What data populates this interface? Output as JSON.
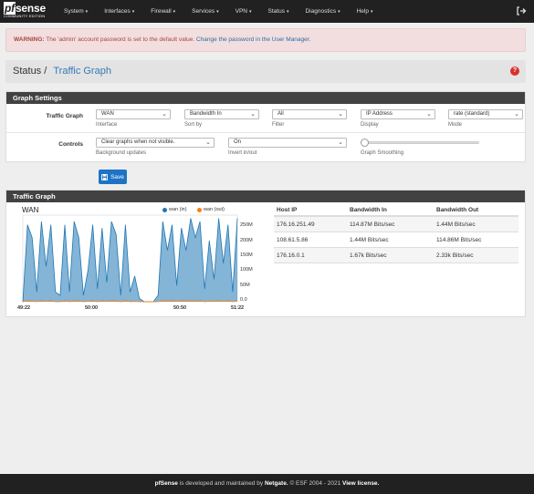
{
  "nav": {
    "logo_main": "sense",
    "logo_pf": "pf",
    "logo_sub": "COMMUNITY EDITION",
    "menu": [
      "System",
      "Interfaces",
      "Firewall",
      "Services",
      "VPN",
      "Status",
      "Diagnostics",
      "Help"
    ]
  },
  "alert": {
    "prefix": "WARNING:",
    "text": " The 'admin' account password is set to the default value. ",
    "link": "Change the password in the User Manager."
  },
  "breadcrumb": {
    "parent": "Status",
    "sep": "/",
    "current": "Traffic Graph"
  },
  "settings": {
    "title": "Graph Settings",
    "traffic_graph_label": "Traffic Graph",
    "interface": {
      "value": "WAN",
      "hint": "Interface"
    },
    "sortby": {
      "value": "Bandwidth In",
      "hint": "Sort by"
    },
    "filter": {
      "value": "All",
      "hint": "Filter"
    },
    "display": {
      "value": "IP Address",
      "hint": "Display"
    },
    "mode": {
      "value": "rate (standard)",
      "hint": "Mode"
    },
    "controls_label": "Controls",
    "background": {
      "value": "Clear graphs when not visible.",
      "hint": "Background updates"
    },
    "invert": {
      "value": "On",
      "hint": "Invert in/out"
    },
    "smoothing": {
      "hint": "Graph Smoothing",
      "level": 0
    },
    "save_label": "Save"
  },
  "graph_panel": {
    "title": "Traffic Graph",
    "chart_title": "WAN",
    "legend_in": "wan (in)",
    "legend_out": "wan (out)",
    "colors": {
      "in": "#1f77b4",
      "out": "#ff7f0e"
    },
    "y_ticks": [
      "250M",
      "200M",
      "150M",
      "100M",
      "50M",
      "0.0"
    ],
    "x_ticks": [
      "49:22",
      "50:00",
      "50:50",
      "51:22"
    ]
  },
  "chart_data": {
    "type": "area",
    "title": "WAN",
    "xlabel": "",
    "ylabel": "",
    "ylim": [
      0,
      270
    ],
    "x_tick_labels": [
      "49:22",
      "50:00",
      "50:50",
      "51:22"
    ],
    "series": [
      {
        "name": "wan (in)",
        "values": [
          0,
          240,
          200,
          30,
          250,
          110,
          240,
          30,
          20,
          240,
          30,
          250,
          200,
          20,
          100,
          240,
          40,
          230,
          60,
          250,
          210,
          20,
          240,
          30,
          80,
          10,
          0,
          0,
          0,
          20,
          250,
          160,
          240,
          50,
          230,
          160,
          260,
          200,
          250,
          40,
          190,
          70,
          260,
          120,
          240,
          30,
          260
        ]
      },
      {
        "name": "wan (out)",
        "values": [
          0,
          3,
          2,
          0,
          3,
          1,
          3,
          0,
          0,
          3,
          0,
          3,
          2,
          0,
          1,
          3,
          0,
          3,
          1,
          3,
          2,
          0,
          3,
          0,
          1,
          0,
          0,
          0,
          0,
          0,
          3,
          2,
          3,
          1,
          3,
          2,
          3,
          2,
          3,
          0,
          2,
          1,
          3,
          1,
          3,
          0,
          3
        ]
      }
    ]
  },
  "table": {
    "headers": [
      "Host IP",
      "Bandwidth In",
      "Bandwidth Out"
    ],
    "rows": [
      [
        "176.16.251.49",
        "114.87M Bits/sec",
        "1.44M Bits/sec"
      ],
      [
        "108.61.5.86",
        "1.44M Bits/sec",
        "114.86M Bits/sec"
      ],
      [
        "176.16.0.1",
        "1.67k Bits/sec",
        "2.33k Bits/sec"
      ]
    ]
  },
  "footer": {
    "brand": "pfSense",
    "text1": " is developed and maintained by ",
    "netgate": "Netgate.",
    "text2": " © ESF 2004 - 2021 ",
    "license": "View license."
  }
}
